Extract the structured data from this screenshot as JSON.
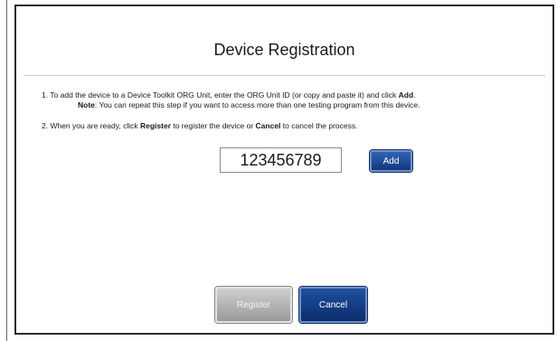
{
  "dialog": {
    "title": "Device Registration"
  },
  "instructions": {
    "step1_prefix": "1. To add the device to a Device Toolkit ORG Unit, enter the ORG Unit ID (or copy and paste it) and click ",
    "step1_bold": "Add",
    "step1_suffix": ".",
    "note_label": "Note",
    "note_text": ": You can repeat this step if you want to access more than one testing program from this device.",
    "step2_prefix": "2. When you are ready, click ",
    "step2_register": "Register",
    "step2_middle": " to register the device or ",
    "step2_cancel": "Cancel",
    "step2_suffix": " to cancel the process."
  },
  "org_unit": {
    "value": "123456789"
  },
  "buttons": {
    "add": "Add",
    "register": "Register",
    "cancel": "Cancel"
  },
  "colors": {
    "button_blue": "#1e4f9f",
    "button_disabled_gray": "#b0b0b0"
  }
}
